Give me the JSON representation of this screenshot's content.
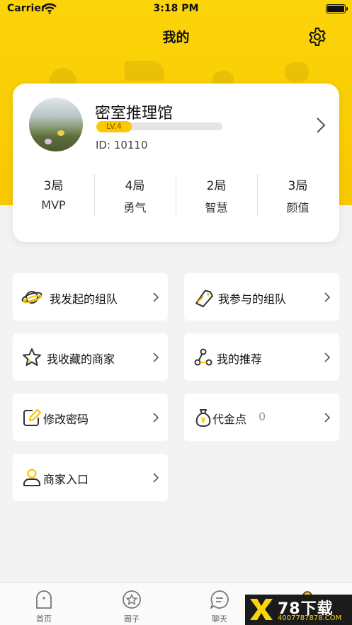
{
  "status_bar": {
    "carrier": "Carrier",
    "time": "3:18 PM"
  },
  "header": {
    "title": "我的",
    "settings_icon": "gear-icon"
  },
  "profile": {
    "name": "密室推理馆",
    "level": "LV.4",
    "id_text": "ID: 10110",
    "stats": [
      {
        "count": "3局",
        "label": "MVP"
      },
      {
        "count": "4局",
        "label": "勇气"
      },
      {
        "count": "2局",
        "label": "智慧"
      },
      {
        "count": "3局",
        "label": "颜值"
      }
    ]
  },
  "menu": {
    "items": [
      {
        "label": "我发起的组队",
        "icon": "planet-icon"
      },
      {
        "label": "我参与的组队",
        "icon": "ticket-icon"
      },
      {
        "label": "我收藏的商家",
        "icon": "star-icon"
      },
      {
        "label": "我的推荐",
        "icon": "share-nodes-icon"
      },
      {
        "label": "修改密码",
        "icon": "edit-icon"
      },
      {
        "label": "代金点",
        "value": "0",
        "icon": "money-bag-icon"
      },
      {
        "label": "商家入口",
        "icon": "user-icon"
      }
    ]
  },
  "tab_bar": {
    "tabs": [
      {
        "label": "首页",
        "icon": "home-icon"
      },
      {
        "label": "圈子",
        "icon": "star-circle-icon"
      },
      {
        "label": "聊天",
        "icon": "chat-icon"
      }
    ]
  },
  "watermark": {
    "title": "78下载",
    "url": "4007787878.COM"
  },
  "colors": {
    "accent": "#fcd40a",
    "accent_dark": "#f8c800",
    "background": "#f3f3f3",
    "icon_dark": "#333333"
  }
}
